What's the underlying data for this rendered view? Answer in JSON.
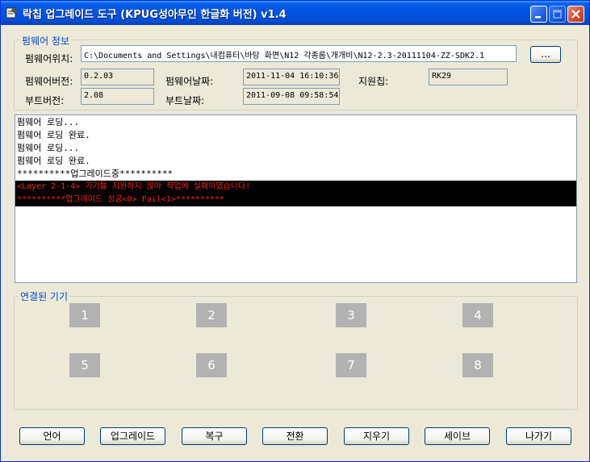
{
  "window": {
    "title": "락칩 업그레이드 도구 (KPUG성아무인 한글화 버전) v1.4"
  },
  "firmware_info": {
    "group_label": "펌웨어 정보",
    "location_label": "펌웨어위치:",
    "location_value": "C:\\Documents and Settings\\내컴퓨터\\바탕 화면\\N12 각종롬\\개개비\\N12-2.3-20111104-ZZ-SDK2.1",
    "browse_label": "...",
    "version_label": "펌웨어버전:",
    "version_value": "0.2.03",
    "date_label": "펌웨어날짜:",
    "date_value": "2011-11-04 16:10:36",
    "chip_label": "지원칩:",
    "chip_value": "RK29",
    "boot_version_label": "부트버전:",
    "boot_version_value": "2.08",
    "boot_date_label": "부트날짜:",
    "boot_date_value": "2011-09-08 09:58:54"
  },
  "log": {
    "lines": [
      "펌웨어 로딩...",
      "펌웨어 로딩 완료.",
      "펌웨어 로딩...",
      "펌웨어 로딩 완료.",
      "**********업그레이드중**********"
    ],
    "errors": [
      "<Layer 2-1-4> 기기를 지원하지 않아 작업에 실패하였습니다!",
      "**********업그레이드 성공<0> Fail<1>**********"
    ]
  },
  "devices": {
    "group_label": "연결된 기기",
    "slots": [
      "1",
      "2",
      "3",
      "4",
      "5",
      "6",
      "7",
      "8"
    ]
  },
  "buttons": {
    "language": "언어",
    "upgrade": "업그레이드",
    "restore": "복구",
    "switch": "전환",
    "erase": "지우기",
    "save": "세이브",
    "exit": "나가기"
  },
  "colors": {
    "titlebar": "#0055e5",
    "group_label": "#0046d5",
    "error_text": "#ff2020",
    "error_bg": "#000000",
    "slot_bg": "#b2b2b2"
  }
}
